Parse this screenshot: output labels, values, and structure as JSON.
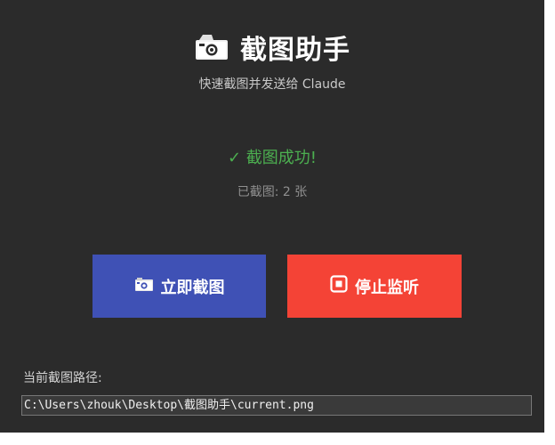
{
  "app": {
    "title": "截图助手",
    "subtitle": "快速截图并发送给 Claude",
    "icon": "camera-icon"
  },
  "status": {
    "message": "✓ 截图成功!",
    "count_text": "已截图: 2 张",
    "color": "#4caf50"
  },
  "buttons": {
    "capture": {
      "label": "立即截图",
      "icon": "camera-icon",
      "color": "#3f51b5"
    },
    "stop": {
      "label": "停止监听",
      "icon": "stop-icon",
      "color": "#f44336"
    }
  },
  "path": {
    "label": "当前截图路径:",
    "value": "C:\\Users\\zhouk\\Desktop\\截图助手\\current.png"
  }
}
